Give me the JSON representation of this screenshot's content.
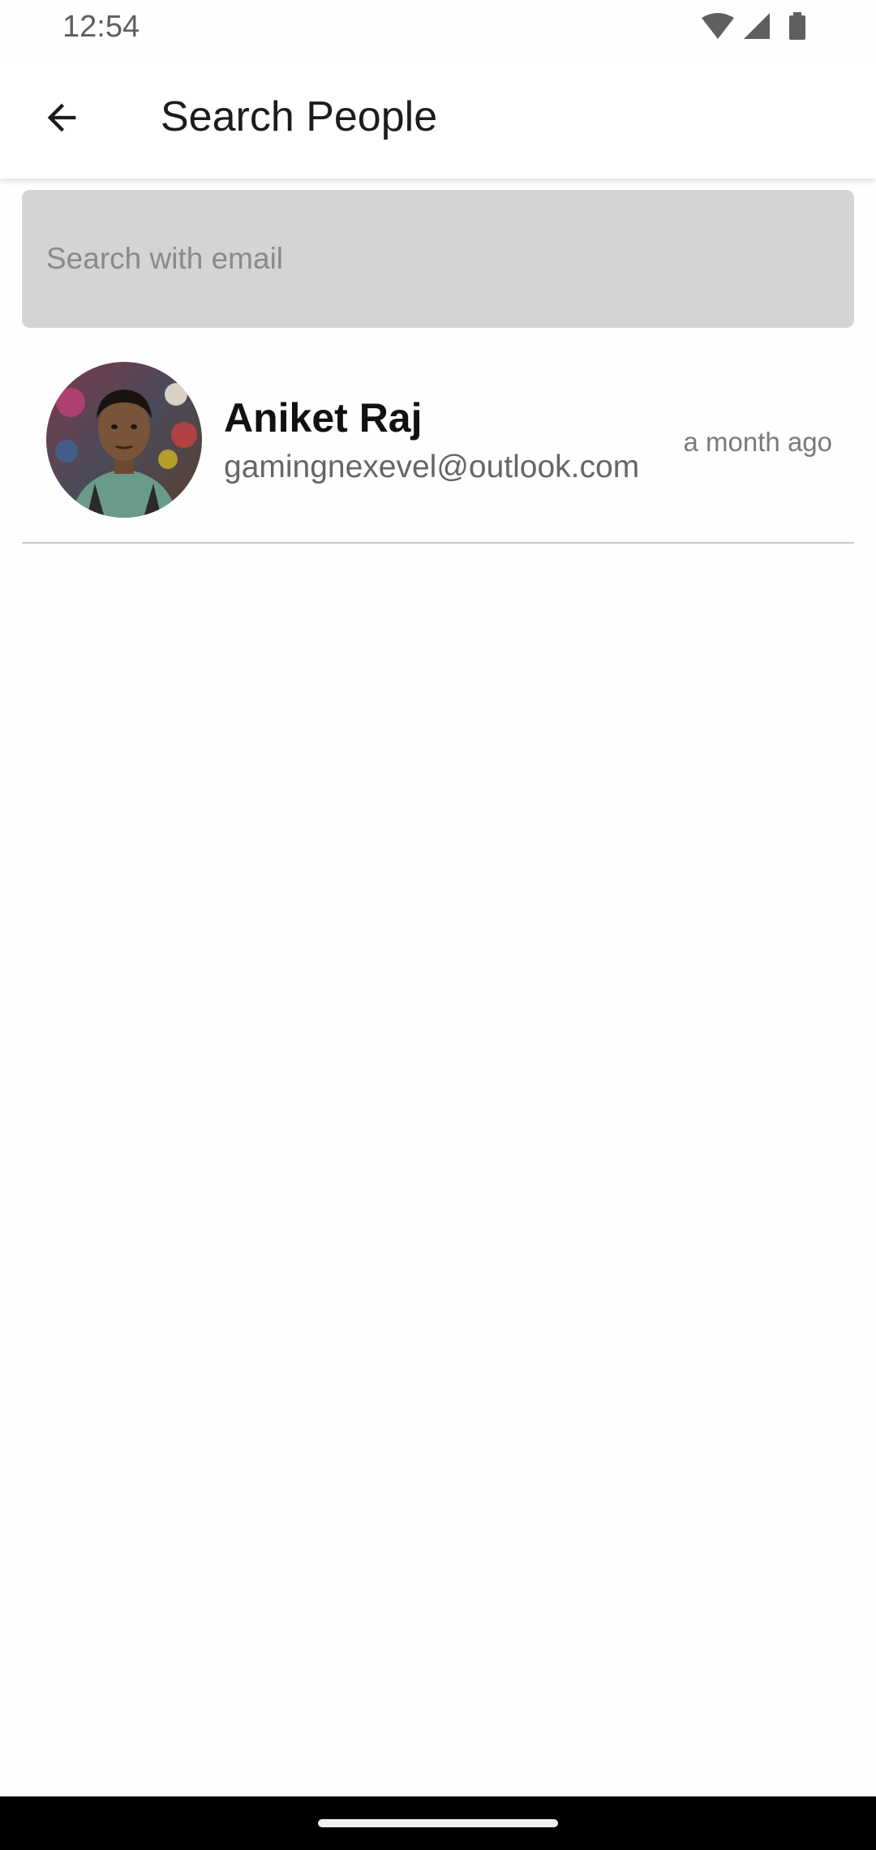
{
  "status_bar": {
    "time": "12:54",
    "icons": [
      "wifi-icon",
      "cellular-signal-icon",
      "battery-icon"
    ]
  },
  "app_bar": {
    "back_icon": "arrow-left-icon",
    "title": "Search People"
  },
  "search": {
    "placeholder": "Search with email",
    "value": ""
  },
  "results": [
    {
      "name": "Aniket Raj",
      "email": "gamingnexevel@outlook.com",
      "time": "a month ago",
      "avatar": "profile-photo"
    }
  ],
  "colors": {
    "search_bg": "#d4d4d4",
    "title_text": "#1c1c1c",
    "secondary_text": "#666666",
    "divider": "#c8c8c8",
    "nav_bar": "#000000"
  }
}
